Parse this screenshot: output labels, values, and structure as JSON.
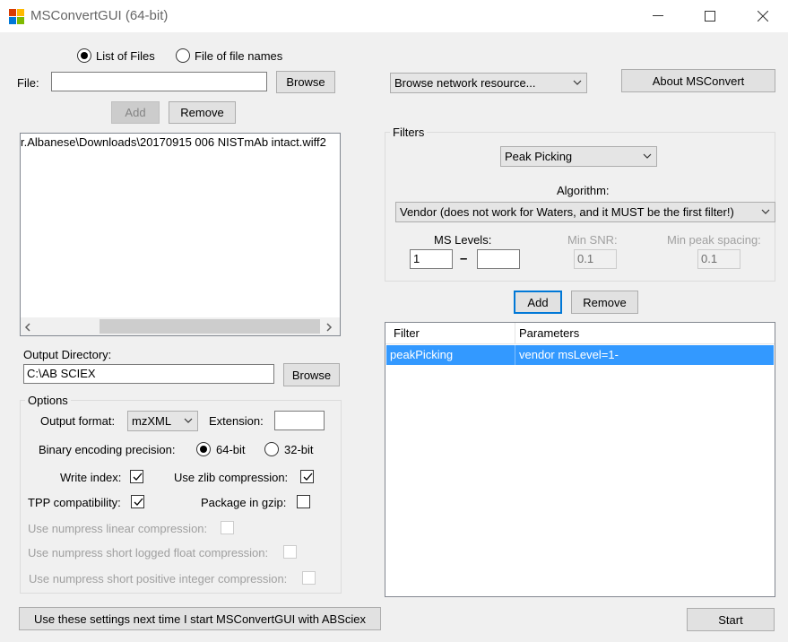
{
  "window": {
    "title": "MSConvertGUI (64-bit)",
    "minimize_glyph": "—",
    "maximize_glyph": "☐",
    "close_glyph": "✕"
  },
  "input_mode": {
    "list_of_files_label": "List of Files",
    "list_of_files_selected": true,
    "file_of_names_label": "File of file names",
    "file_of_names_selected": false
  },
  "file": {
    "label": "File:",
    "value": "",
    "browse_label": "Browse",
    "add_label": "Add",
    "remove_label": "Remove"
  },
  "file_list": {
    "items": [
      "r.Albanese\\Downloads\\20170915 006 NISTmAb intact.wiff2"
    ],
    "scroll_left_glyph": "‹",
    "scroll_right_glyph": "›"
  },
  "network": {
    "combo_value": "Browse network resource..."
  },
  "about_label": "About MSConvert",
  "output": {
    "label": "Output Directory:",
    "value": "C:\\AB SCIEX",
    "browse_label": "Browse"
  },
  "options": {
    "title": "Options",
    "output_format_label": "Output format:",
    "output_format_value": "mzXML",
    "extension_label": "Extension:",
    "extension_value": "",
    "binary_precision_label": "Binary encoding precision:",
    "precision_64_label": "64-bit",
    "precision_64_selected": true,
    "precision_32_label": "32-bit",
    "precision_32_selected": false,
    "write_index_label": "Write index:",
    "write_index_checked": true,
    "zlib_label": "Use zlib compression:",
    "zlib_checked": true,
    "tpp_label": "TPP compatibility:",
    "tpp_checked": true,
    "gzip_label": "Package in gzip:",
    "gzip_checked": false,
    "numpress_linear_label": "Use numpress linear compression:",
    "numpress_slof_label": "Use numpress short logged float compression:",
    "numpress_pic_label": "Use numpress short positive integer compression:"
  },
  "filters": {
    "title": "Filters",
    "filter_combo_value": "Peak Picking",
    "algorithm_label": "Algorithm:",
    "algorithm_value": "Vendor (does not work for Waters, and it MUST be the first filter!)",
    "ms_levels_label": "MS Levels:",
    "ms_level_min": "1",
    "ms_level_dash": "–",
    "ms_level_max": "",
    "min_snr_label": "Min SNR:",
    "min_snr_value": "0.1",
    "min_peak_spacing_label": "Min peak spacing:",
    "min_peak_spacing_value": "0.1",
    "add_label": "Add",
    "remove_label": "Remove"
  },
  "filter_table": {
    "columns": [
      "Filter",
      "Parameters"
    ],
    "rows": [
      {
        "filter": "peakPicking",
        "parameters": "vendor msLevel=1-"
      }
    ]
  },
  "bottom": {
    "save_settings_label": "Use these settings next time I start MSConvertGUI with ABSciex",
    "start_label": "Start"
  },
  "colors": {
    "selection": "#3399ff",
    "focus_border": "#0078d7",
    "window_bg": "#f0f0f0"
  }
}
